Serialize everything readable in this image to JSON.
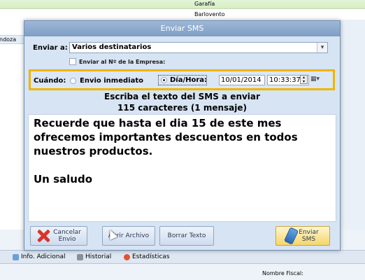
{
  "background": {
    "row1_text": "Garafía",
    "row2_text": "Barlovento",
    "row3_text": "ndoza",
    "tabs": [
      {
        "label": "Info. Adicional",
        "icon": "info-icon"
      },
      {
        "label": "Historial",
        "icon": "history-icon"
      },
      {
        "label": "Estadísticas",
        "icon": "stats-icon"
      }
    ],
    "footer_label": "Nombre Fiscal:"
  },
  "dialog": {
    "title": "Enviar SMS",
    "send_to_label": "Enviar a:",
    "send_to_value": "Varios destinatarios",
    "company_number_label": "Enviar al Nº de la Empresa:",
    "company_number_checked": false,
    "when_label": "Cuándo:",
    "immediate_label": "Envio inmediato",
    "immediate_selected": false,
    "datetime_label": "Día/Hora:",
    "datetime_selected": true,
    "date_value": "10/01/2014",
    "time_value": "10:33:37",
    "instruction_line1": "Escriba el texto del SMS a enviar",
    "instruction_line2": "115 caracteres (1 mensaje)",
    "message_text": "Recuerde que hasta el dia 15 de este mes ofrecemos importantes descuentos en todos nuestros productos.\n\nUn saludo",
    "buttons": {
      "cancel_line1": "Cancelar",
      "cancel_line2": "Envio",
      "open_file": "Abrir Archivo",
      "clear_text": "Borrar Texto",
      "send_line1": "Enviar",
      "send_line2": "SMS"
    }
  },
  "colors": {
    "highlight": "#f0b400",
    "title_bar": "#8aa7cc",
    "cancel_icon": "#d8342b"
  }
}
